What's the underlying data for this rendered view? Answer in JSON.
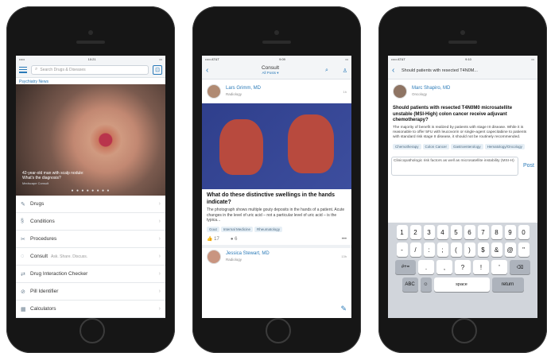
{
  "phone1": {
    "status_carrier": "•••••",
    "status_time": "10:21",
    "search_placeholder": "Search Drugs & Diseases",
    "news_label": "Psychiatry News",
    "hero_caption_line1": "42-year-old man with scalp nodule:",
    "hero_caption_line2": "What's the diagnosis?",
    "hero_source": "Medscape Consult",
    "menu": [
      {
        "label": "Drugs",
        "sub": ""
      },
      {
        "label": "Conditions",
        "sub": ""
      },
      {
        "label": "Procedures",
        "sub": ""
      },
      {
        "label": "Consult",
        "sub": "Ask. Share. Discuss."
      },
      {
        "label": "Drug Interaction Checker",
        "sub": ""
      },
      {
        "label": "Pill Identifier",
        "sub": ""
      },
      {
        "label": "Calculators",
        "sub": ""
      }
    ]
  },
  "phone2": {
    "status_carrier": "••••• AT&T",
    "status_time": "9:09",
    "title": "Consult",
    "subtitle": "All Posts ▾",
    "author": "Lars Grimm, MD",
    "author_dept": "Radiology",
    "time": "1h",
    "question": "What do these distinctive swellings in the hands indicate?",
    "body": "The photograph shows multiple gouty deposits in the hands of a patient. Acute changes in the level of uric acid – not a particular level of uric acid – is the typica...",
    "tags": [
      "Gout",
      "Internal Medicine",
      "Rheumatology"
    ],
    "likes": "17",
    "comments": "6",
    "author2": "Jessica Stewart, MD",
    "author2_dept": "Radiology",
    "time2": "13h"
  },
  "phone3": {
    "status_carrier": "••••• AT&T",
    "status_time": "9:10",
    "title": "Should patients with resected T4N0M...",
    "author": "Marc Shapiro, MD",
    "author_dept": "Oncology",
    "question": "Should patients with resected T4N0M0 microsatellite unstable (MSI-High) colon cancer receive adjuvant chemotherapy?",
    "body": "The majority of benefit is realized by patients with stage III disease. While it is reasonable to offer 5FU with leucovorin or single-agent capecitabine to patients with standard risk stage II disease, it should not be routinely recommended.",
    "tags": [
      "Chemotherapy",
      "Colon Cancer",
      "Gastroenterology",
      "Hematology/Oncology"
    ],
    "reply_text": "Clinicopathologic risk factors as well as microsatellite instability (MSI-H)",
    "post_label": "Post",
    "keyboard_row1": [
      "1",
      "2",
      "3",
      "4",
      "5",
      "6",
      "7",
      "8",
      "9",
      "0"
    ],
    "keyboard_row2": [
      "-",
      "/",
      ":",
      ";",
      "(",
      ")",
      "$",
      "&",
      "@",
      "\""
    ],
    "keyboard_row3": [
      ".",
      ",",
      "?",
      "!",
      "'"
    ],
    "key_shift": "#+=",
    "key_delete": "⌫",
    "key_abc": "ABC",
    "key_space": "space",
    "key_return": "return"
  }
}
